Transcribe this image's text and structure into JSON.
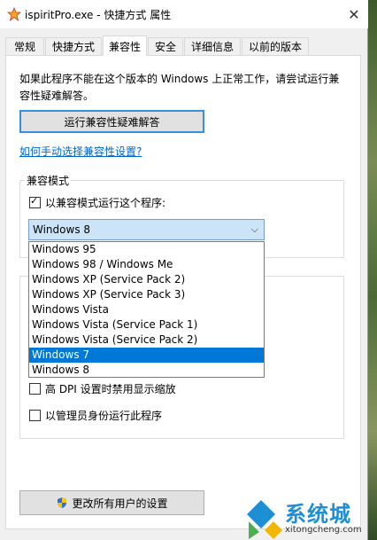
{
  "window": {
    "title": "ispiritPro.exe - 快捷方式 属性",
    "close_glyph": "✕"
  },
  "tabs": [
    {
      "label": "常规"
    },
    {
      "label": "快捷方式"
    },
    {
      "label": "兼容性",
      "active": true
    },
    {
      "label": "安全"
    },
    {
      "label": "详细信息"
    },
    {
      "label": "以前的版本"
    }
  ],
  "compat": {
    "description": "如果此程序不能在这个版本的 Windows 上正常工作，请尝试运行兼容性疑难解答。",
    "troubleshoot_button": "运行兼容性疑难解答",
    "manual_link": "如何手动选择兼容性设置?",
    "mode_group_title": "兼容模式",
    "mode_checkbox": "以兼容模式运行这个程序:",
    "selected_os": "Windows 8",
    "os_options": [
      "Windows 95",
      "Windows 98 / Windows Me",
      "Windows XP (Service Pack 2)",
      "Windows XP (Service Pack 3)",
      "Windows Vista",
      "Windows Vista (Service Pack 1)",
      "Windows Vista (Service Pack 2)",
      "Windows 7",
      "Windows 8"
    ],
    "highlighted_option": "Windows 7",
    "dpi_checkbox": "高 DPI 设置时禁用显示缩放",
    "admin_checkbox": "以管理员身份运行此程序",
    "all_users_button": "更改所有用户的设置"
  },
  "watermark": {
    "brand": "系统城",
    "domain": "xitongcheng.com"
  },
  "colors": {
    "accent": "#0078d7",
    "link": "#0066cc",
    "select_bg": "#cce4f7"
  }
}
